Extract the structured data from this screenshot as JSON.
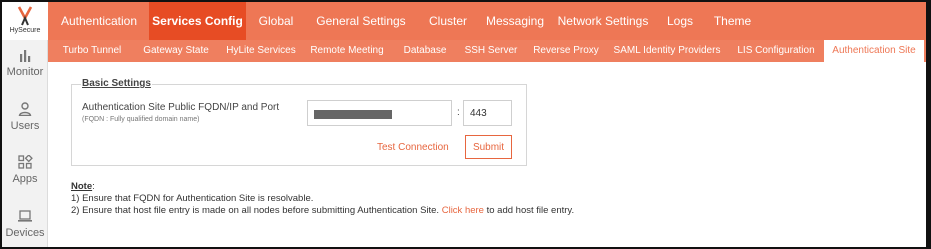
{
  "brand": {
    "name": "HySecure"
  },
  "sidebar": {
    "items": [
      {
        "label": "Monitor",
        "icon": "bar-chart-icon"
      },
      {
        "label": "Users",
        "icon": "user-icon"
      },
      {
        "label": "Apps",
        "icon": "apps-grid-icon"
      },
      {
        "label": "Devices",
        "icon": "laptop-icon"
      }
    ]
  },
  "topnav": {
    "tabs": [
      {
        "label": "Authentication"
      },
      {
        "label": "Services Config",
        "active": true
      },
      {
        "label": "Global"
      },
      {
        "label": "General Settings"
      },
      {
        "label": "Cluster"
      },
      {
        "label": "Messaging"
      },
      {
        "label": "Network Settings"
      },
      {
        "label": "Logs"
      },
      {
        "label": "Theme"
      }
    ]
  },
  "subnav": {
    "tabs": [
      {
        "label": "Turbo Tunnel"
      },
      {
        "label": "Gateway State"
      },
      {
        "label": "HyLite Services"
      },
      {
        "label": "Remote Meeting"
      },
      {
        "label": "Database"
      },
      {
        "label": "SSH Server"
      },
      {
        "label": "Reverse Proxy"
      },
      {
        "label": "SAML Identity Providers"
      },
      {
        "label": "LIS Configuration"
      },
      {
        "label": "Authentication Site",
        "active": true
      }
    ]
  },
  "basic_settings": {
    "title": "Basic Settings",
    "field_label": "Authentication Site Public FQDN/IP and Port",
    "field_help": "(FQDN : Fully qualified domain name)",
    "separator": ":",
    "port_value": "443",
    "test_label": "Test Connection",
    "submit_label": "Submit"
  },
  "note": {
    "title": "Note",
    "title_suffix": ":",
    "line1": "1) Ensure that FQDN for Authentication Site is resolvable.",
    "line2_prefix": "2) Ensure that host file entry is made on all nodes before submitting Authentication Site.",
    "line2_link": "Click here",
    "line2_suffix": "to add host file entry."
  },
  "colors": {
    "brand_orange": "#ee7755",
    "active_tab": "#e74c24",
    "link": "#e7663f"
  }
}
